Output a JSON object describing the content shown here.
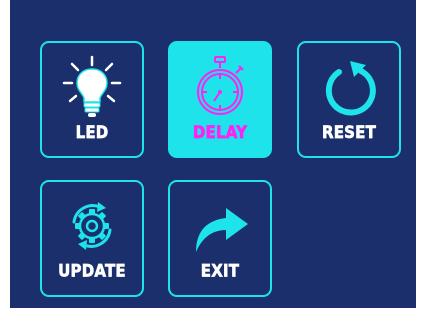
{
  "menu": {
    "items": [
      {
        "label": "LED",
        "icon": "lightbulb-icon",
        "selected": false
      },
      {
        "label": "DELAY",
        "icon": "stopwatch-icon",
        "selected": true
      },
      {
        "label": "RESET",
        "icon": "reset-icon",
        "selected": false
      },
      {
        "label": "UPDATE",
        "icon": "gear-refresh-icon",
        "selected": false
      },
      {
        "label": "EXIT",
        "icon": "exit-arrow-icon",
        "selected": false
      }
    ]
  },
  "colors": {
    "background": "#1a2f6b",
    "accent": "#1ee3ea",
    "selected_text": "#ff22f2",
    "text": "#ffffff"
  }
}
